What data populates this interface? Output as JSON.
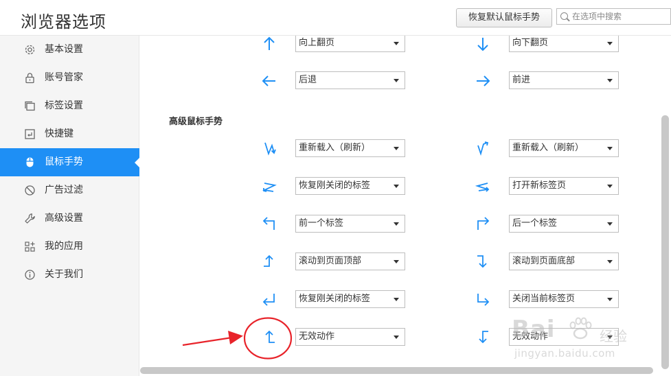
{
  "header": {
    "title": "浏览器选项",
    "restore_button": "恢复默认鼠标手势",
    "search_placeholder": "在选项中搜索"
  },
  "sidebar": {
    "items": [
      {
        "label": "基本设置",
        "icon": "gear-icon"
      },
      {
        "label": "账号管家",
        "icon": "lock-icon"
      },
      {
        "label": "标签设置",
        "icon": "tabs-icon"
      },
      {
        "label": "快捷键",
        "icon": "keyboard-shortcut-icon"
      },
      {
        "label": "鼠标手势",
        "icon": "mouse-icon",
        "active": true
      },
      {
        "label": "广告过滤",
        "icon": "block-icon"
      },
      {
        "label": "高级设置",
        "icon": "wrench-icon"
      },
      {
        "label": "我的应用",
        "icon": "apps-grid-icon"
      },
      {
        "label": "关于我们",
        "icon": "info-icon"
      }
    ]
  },
  "basic_gestures": [
    {
      "left": {
        "icon": "arrow-up",
        "action": "向上翻页"
      },
      "right": {
        "icon": "arrow-down",
        "action": "向下翻页"
      }
    },
    {
      "left": {
        "icon": "arrow-left",
        "action": "后退"
      },
      "right": {
        "icon": "arrow-right",
        "action": "前进"
      }
    }
  ],
  "advanced_section_title": "高级鼠标手势",
  "advanced_gestures": [
    {
      "left": {
        "icon": "down-up-gesture",
        "action": "重新载入（刷新）"
      },
      "right": {
        "icon": "up-down-gesture",
        "action": "重新载入（刷新）"
      }
    },
    {
      "left": {
        "icon": "right-left-gesture",
        "action": "恢复刚关闭的标签"
      },
      "right": {
        "icon": "left-right-gesture",
        "action": "打开新标签页"
      }
    },
    {
      "left": {
        "icon": "up-left-gesture",
        "action": "前一个标签"
      },
      "right": {
        "icon": "up-right-gesture",
        "action": "后一个标签"
      }
    },
    {
      "left": {
        "icon": "right-up-gesture",
        "action": "滚动到页面顶部"
      },
      "right": {
        "icon": "right-down-gesture",
        "action": "滚动到页面底部"
      }
    },
    {
      "left": {
        "icon": "up-left-return-gesture",
        "action": "恢复刚关闭的标签"
      },
      "right": {
        "icon": "down-right-gesture",
        "action": "关闭当前标签页"
      }
    },
    {
      "left": {
        "icon": "left-up-gesture",
        "action": "无效动作"
      },
      "right": {
        "icon": "left-down-gesture",
        "action": "无效动作"
      }
    }
  ],
  "colors": {
    "accent": "#1e8ff5",
    "annotation": "#e8232a"
  },
  "watermark": {
    "brand": "Bai",
    "brand_cn": "经验",
    "url": "jingyan.baidu.com"
  }
}
